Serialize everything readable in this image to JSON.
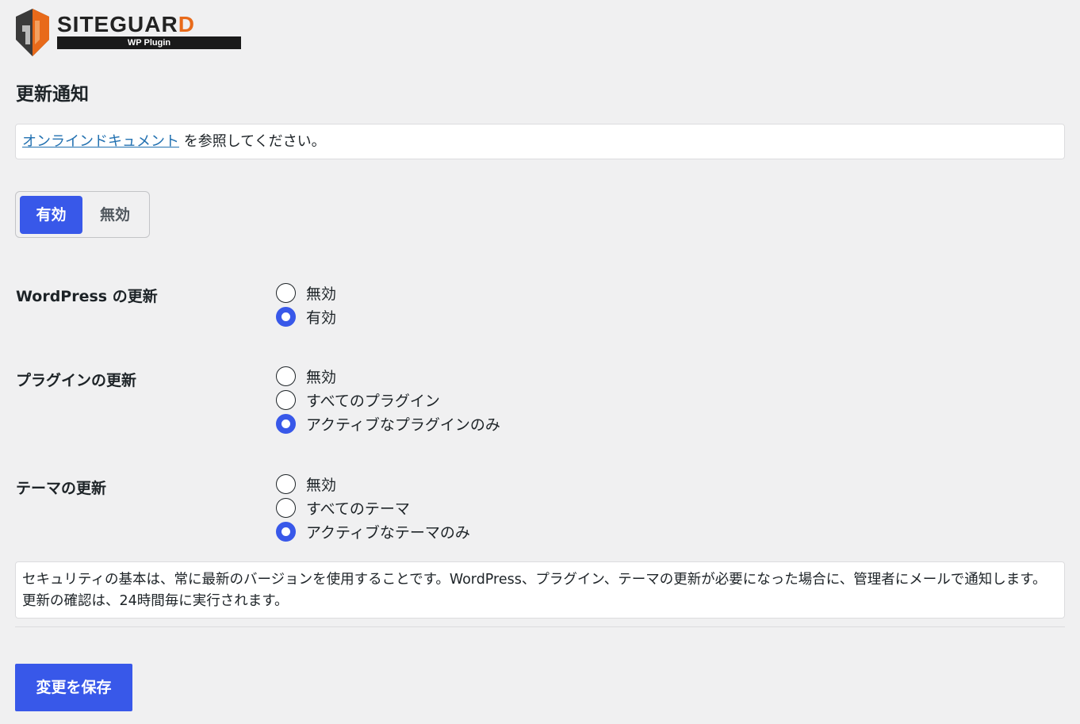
{
  "logo": {
    "wordmark_main": "SITEGUAR",
    "wordmark_last": "D",
    "subtitle": "WP Plugin",
    "accent_color": "#e86a1a"
  },
  "page_title": "更新通知",
  "notice": {
    "link_text": "オンラインドキュメント",
    "rest_text": " を参照してください。"
  },
  "toggle": {
    "on_label": "有効",
    "off_label": "無効",
    "selected": "有効",
    "accent_color": "#3858e9"
  },
  "settings": [
    {
      "label": "WordPress の更新",
      "options": [
        {
          "label": "無効",
          "checked": false
        },
        {
          "label": "有効",
          "checked": true
        }
      ]
    },
    {
      "label": "プラグインの更新",
      "options": [
        {
          "label": "無効",
          "checked": false
        },
        {
          "label": "すべてのプラグイン",
          "checked": false
        },
        {
          "label": "アクティブなプラグインのみ",
          "checked": true
        }
      ]
    },
    {
      "label": "テーマの更新",
      "options": [
        {
          "label": "無効",
          "checked": false
        },
        {
          "label": "すべてのテーマ",
          "checked": false
        },
        {
          "label": "アクティブなテーマのみ",
          "checked": true
        }
      ]
    }
  ],
  "description": "セキュリティの基本は、常に最新のバージョンを使用することです。WordPress、プラグイン、テーマの更新が必要になった場合に、管理者にメールで通知します。更新の確認は、24時間毎に実行されます。",
  "save_button": "変更を保存"
}
